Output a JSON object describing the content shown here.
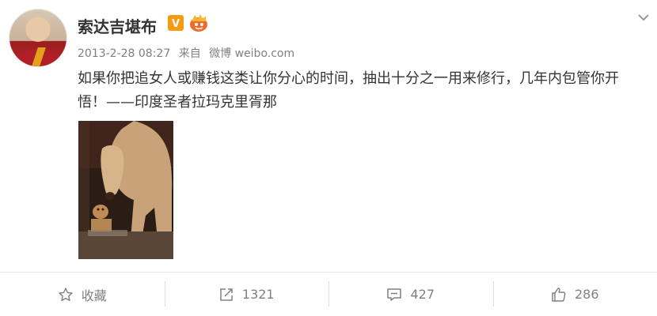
{
  "post": {
    "author": "索达吉堪布",
    "badges": {
      "verified": "V",
      "verified_icon": "verified-v-icon",
      "member_icon": "crown-member-icon"
    },
    "timestamp": "2013-2-28 08:27",
    "source_prefix": "来自",
    "source": "微博 weibo.com",
    "text": "如果你把追女人或赚钱这类让你分心的时间，抽出十分之一用来修行，几年内包管你开悟！——印度圣者拉玛克里胥那",
    "image": {
      "description_icon": "lion-cub-photo"
    }
  },
  "actions": {
    "favorite": {
      "icon": "star-icon",
      "label": "收藏"
    },
    "repost": {
      "icon": "repost-icon",
      "count": "1321"
    },
    "comment": {
      "icon": "comment-icon",
      "count": "427"
    },
    "like": {
      "icon": "thumbs-up-icon",
      "count": "286"
    }
  },
  "colors": {
    "text": "#333333",
    "meta": "#808080",
    "verified": "#f39c12",
    "divider": "#e6e6e6"
  }
}
